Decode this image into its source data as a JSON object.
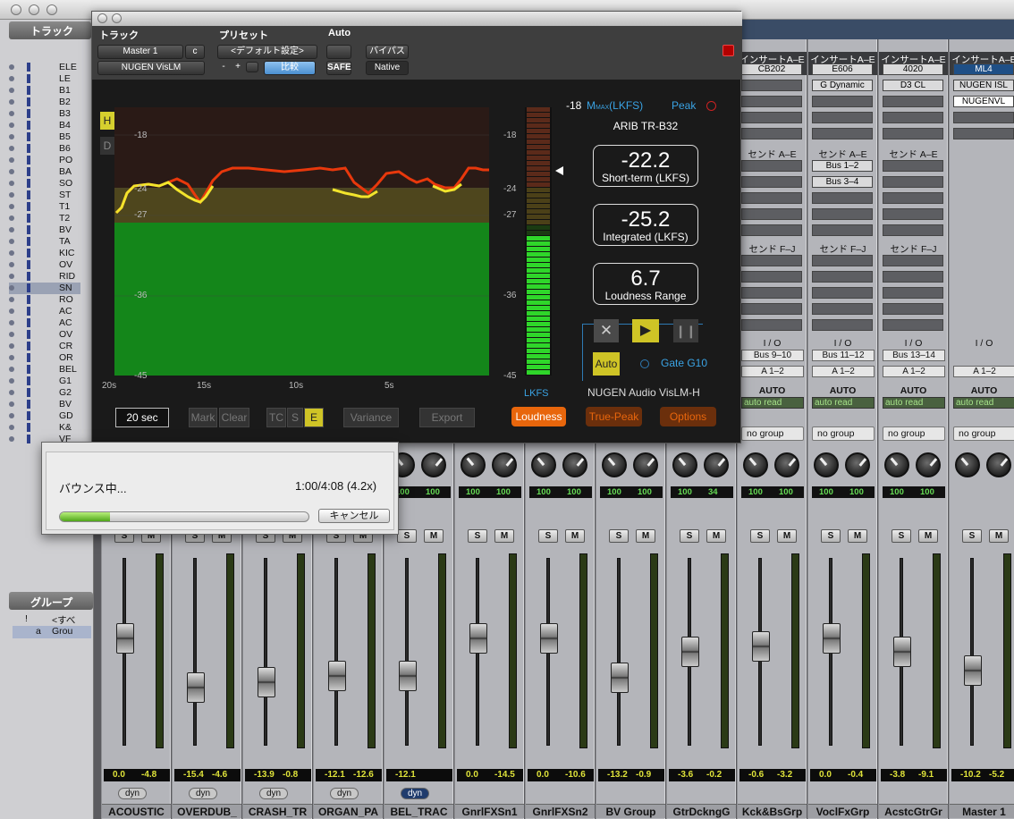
{
  "track_panel": {
    "title": "トラック",
    "tracks": [
      "ELE",
      "LE",
      "B1",
      "B2",
      "B3",
      "B4",
      "B5",
      "B6",
      "PO",
      "BA",
      "SO",
      "ST",
      "T1",
      "T2",
      "BV",
      "TA",
      "KIC",
      "OV",
      "RID",
      "SN",
      "RO",
      "AC",
      "AC",
      "OV",
      "CR",
      "OR",
      "BEL",
      "G1",
      "G2",
      "BV",
      "GD",
      "K&",
      "VF"
    ],
    "selected": "SN"
  },
  "group_panel": {
    "title": "グループ",
    "rows": [
      {
        "id": "!",
        "name": "<すべ"
      },
      {
        "id": "a",
        "name": "Grou"
      }
    ]
  },
  "plugin": {
    "labels": {
      "track": "トラック",
      "preset": "プリセット",
      "auto": "Auto"
    },
    "track_name": "Master 1",
    "track_suffix": "c",
    "plugin_name": "NUGEN VisLM",
    "preset_name": "<デフォルト設定>",
    "minus": "-",
    "plus": "+",
    "compare": "比較",
    "safe": "SAFE",
    "bypass": "バイパス",
    "native": "Native",
    "hd": {
      "h": "H",
      "d": "D"
    },
    "graph_yticks": [
      "-18",
      "-24",
      "-27",
      "-36",
      "-45"
    ],
    "time_labels": [
      "20s",
      "15s",
      "10s",
      "5s"
    ],
    "meter_ticks": [
      "-18",
      "-24",
      "-27",
      "-36",
      "-45"
    ],
    "meter_unit": "LKFS",
    "mmax": {
      "target": "-18",
      "label": "M",
      "sub": "MAX",
      "suffix": "(LKFS)",
      "peak": "Peak"
    },
    "standard": "ARIB TR-B32",
    "short_term": {
      "value": "-22.2",
      "label": "Short-term (LKFS)"
    },
    "integrated": {
      "value": "-25.2",
      "label": "Integrated (LKFS)"
    },
    "lra": {
      "value": "6.7",
      "label": "Loudness Range"
    },
    "auto_btn": "Auto",
    "gate": "Gate G10",
    "brand": "NUGEN Audio VisLM-H",
    "duration": "20 sec",
    "mark": "Mark",
    "clear": "Clear",
    "tc": "TC",
    "s": "S",
    "e": "E",
    "variance": "Variance",
    "export": "Export",
    "tabs": {
      "loudness": "Loudness",
      "truepeak": "True-Peak",
      "options": "Options"
    },
    "colors": {
      "accent": "#e8660c",
      "yellow": "#e6d63a",
      "green": "#1a9a1a"
    }
  },
  "mixer": {
    "strips": [
      {
        "ins_head": "",
        "inserts": [],
        "send_ae": "",
        "sends": [],
        "send_fj": "",
        "io": "",
        "out": "",
        "auto": "",
        "group": "",
        "pan": [
          "",
          ""
        ],
        "vol": [
          "0.0",
          "-4.8"
        ],
        "name": "ACOUSTIC",
        "fader": 0.57
      },
      {
        "ins_head": "",
        "inserts": [],
        "send_ae": "",
        "sends": [],
        "send_fj": "",
        "io": "",
        "out": "",
        "auto": "",
        "group": "",
        "pan": [
          "",
          ""
        ],
        "vol": [
          "-15.4",
          "-4.6"
        ],
        "name": "OVERDUB_",
        "fader": 0.31
      },
      {
        "ins_head": "",
        "inserts": [],
        "send_ae": "",
        "sends": [],
        "send_fj": "",
        "io": "",
        "out": "",
        "auto": "",
        "group": "",
        "pan": [
          "",
          ""
        ],
        "vol": [
          "-13.9",
          "-0.8"
        ],
        "name": "CRASH_TR",
        "fader": 0.34
      },
      {
        "ins_head": "",
        "inserts": [],
        "send_ae": "",
        "sends": [],
        "send_fj": "",
        "io": "",
        "out": "",
        "auto": "",
        "group": "",
        "pan": [
          "",
          ""
        ],
        "vol": [
          "-12.1",
          "-12.6"
        ],
        "name": "ORGAN_PA",
        "fader": 0.37
      },
      {
        "ins_head": "",
        "inserts": [],
        "send_ae": "",
        "sends": [],
        "send_fj": "",
        "io": "",
        "out": "",
        "auto": "",
        "group": "",
        "pan": [
          "100",
          "100"
        ],
        "vol": [
          "-12.1",
          ""
        ],
        "name": "BEL_TRAC",
        "fader": 0.37
      },
      {
        "ins_head": "",
        "inserts": [],
        "send_ae": "",
        "sends": [],
        "send_fj": "",
        "io": "",
        "out": "",
        "auto": "",
        "group": "",
        "pan": [
          "100",
          "100"
        ],
        "vol": [
          "0.0",
          "-14.5"
        ],
        "name": "GnrlFXSn1",
        "fader": 0.57
      },
      {
        "ins_head": "",
        "inserts": [],
        "send_ae": "",
        "sends": [],
        "send_fj": "",
        "io": "",
        "out": "",
        "auto": "",
        "group": "",
        "pan": [
          "100",
          "100"
        ],
        "vol": [
          "0.0",
          "-10.6"
        ],
        "name": "GnrlFXSn2",
        "fader": 0.57
      },
      {
        "ins_head": "",
        "inserts": [],
        "send_ae": "",
        "sends": [],
        "send_fj": "",
        "io": "",
        "out": "",
        "auto": "",
        "group": "",
        "pan": [
          "100",
          "100"
        ],
        "vol": [
          "-13.2",
          "-0.9"
        ],
        "name": "BV Group",
        "fader": 0.36
      },
      {
        "ins_head": "",
        "inserts": [],
        "send_ae": "",
        "sends": [],
        "send_fj": "",
        "io": "",
        "out": "",
        "auto": "",
        "group": "",
        "pan": [
          "100",
          "34"
        ],
        "vol": [
          "-3.6",
          "-0.2"
        ],
        "name": "GtrDckngG",
        "fader": 0.5
      },
      {
        "ins_head": "インサートA–E",
        "inserts": [
          "CB202",
          "",
          "",
          "",
          ""
        ],
        "send_ae": "センド A–E",
        "sends": [
          "",
          "",
          "",
          "",
          ""
        ],
        "send_fj": "センド F–J",
        "io": "I / O",
        "io_in": "Bus 9–10",
        "out": "A 1–2",
        "auto": "AUTO",
        "autoread": "auto read",
        "group": "no group",
        "pan": [
          "100",
          "100"
        ],
        "vol": [
          "-0.6",
          "-3.2"
        ],
        "name": "Kck&BsGrp",
        "fader": 0.53
      },
      {
        "ins_head": "インサートA–E",
        "inserts": [
          "E606",
          "G Dynamic",
          "",
          "",
          ""
        ],
        "send_ae": "センド A–E",
        "sends": [
          "Bus 1–2",
          "Bus 3–4",
          "",
          "",
          ""
        ],
        "send_fj": "センド F–J",
        "io": "I / O",
        "io_in": "Bus 11–12",
        "out": "A 1–2",
        "auto": "AUTO",
        "autoread": "auto read",
        "group": "no group",
        "pan": [
          "100",
          "100"
        ],
        "vol": [
          "0.0",
          "-0.4"
        ],
        "name": "VoclFxGrp",
        "fader": 0.57
      },
      {
        "ins_head": "インサートA–E",
        "inserts": [
          "4020",
          "D3 CL",
          "",
          "",
          ""
        ],
        "send_ae": "センド A–E",
        "sends": [
          "",
          "",
          "",
          "",
          ""
        ],
        "send_fj": "センド F–J",
        "io": "I / O",
        "io_in": "Bus 13–14",
        "out": "A 1–2",
        "auto": "AUTO",
        "autoread": "auto read",
        "group": "no group",
        "pan": [
          "100",
          "100"
        ],
        "vol": [
          "-3.8",
          "-9.1"
        ],
        "name": "AcstcGtrGr",
        "fader": 0.5
      },
      {
        "ins_head": "インサートA–E",
        "inserts": [
          "ML4",
          "NUGEN ISL",
          "NUGENVL",
          "",
          ""
        ],
        "send_ae": "",
        "sends": [],
        "send_fj": "",
        "io": "I / O",
        "io_in": "",
        "out": "A 1–2",
        "auto": "AUTO",
        "autoread": "auto read",
        "group": "no group",
        "pan": [
          "",
          ""
        ],
        "vol": [
          "-10.2",
          "-5.2"
        ],
        "name": "Master 1",
        "fader": 0.4
      }
    ],
    "scale": [
      "12",
      "6",
      "5",
      "0",
      "5",
      "10",
      "15",
      "20",
      "25",
      "30",
      "40",
      "60",
      "∞"
    ],
    "meter_scale": [
      "6",
      "5",
      "10",
      "15",
      "20",
      "25",
      "30",
      "40",
      "50",
      "60"
    ],
    "dyn": "dyn",
    "solo": "S",
    "mute": "M"
  },
  "bounce": {
    "title": "バウンス中...",
    "time": "1:00/4:08 (4.2x)",
    "progress": 0.2,
    "cancel": "キャンセル"
  }
}
